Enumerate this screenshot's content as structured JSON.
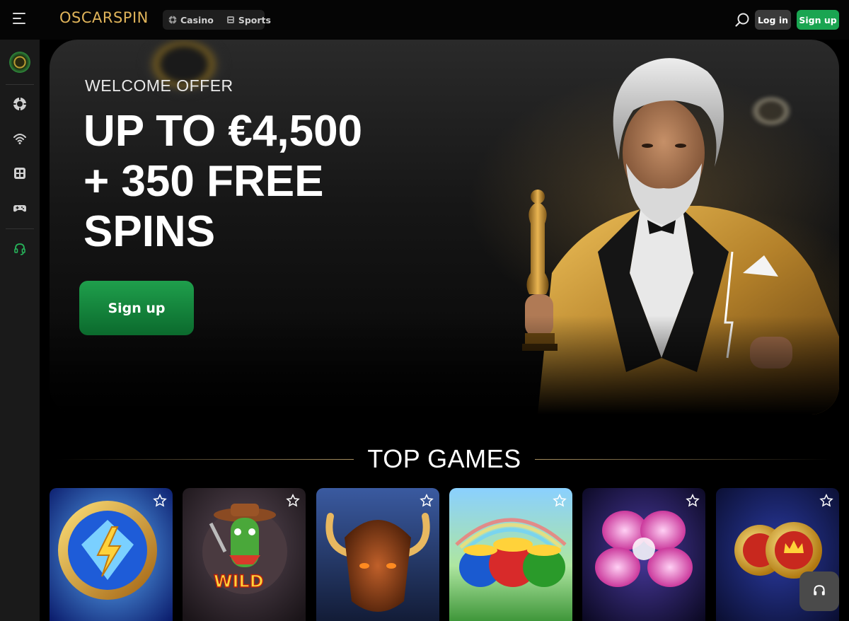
{
  "header": {
    "logo_text": "OSCARSPIN",
    "nav": [
      {
        "label": "Casino",
        "icon": "casino-chip-icon"
      },
      {
        "label": "Sports",
        "icon": "sports-icon"
      }
    ],
    "login_label": "Log in",
    "signup_label": "Sign up",
    "brand_green": "#1aa551",
    "brand_gold": "#e0b45a"
  },
  "sidebar": {
    "items": [
      {
        "icon": "logo-badge-icon"
      },
      {
        "icon": "casino-chip-icon"
      },
      {
        "icon": "live-signal-icon"
      },
      {
        "icon": "slot-machine-icon"
      },
      {
        "icon": "gamepad-icon"
      },
      {
        "icon": "support-headset-icon"
      }
    ]
  },
  "hero": {
    "eyebrow": "WELCOME OFFER",
    "title_lines": [
      "UP TO €4,500",
      "+ 350 FREE",
      "SPINS"
    ],
    "cta_label": "Sign up"
  },
  "top_games": {
    "title": "TOP GAMES",
    "games": [
      {
        "art": "lightning-coin"
      },
      {
        "art": "cactus-wild",
        "badge": "WILD"
      },
      {
        "art": "buffalo"
      },
      {
        "art": "pots-of-gold"
      },
      {
        "art": "pink-gem-clover"
      },
      {
        "art": "gold-coins"
      }
    ]
  }
}
